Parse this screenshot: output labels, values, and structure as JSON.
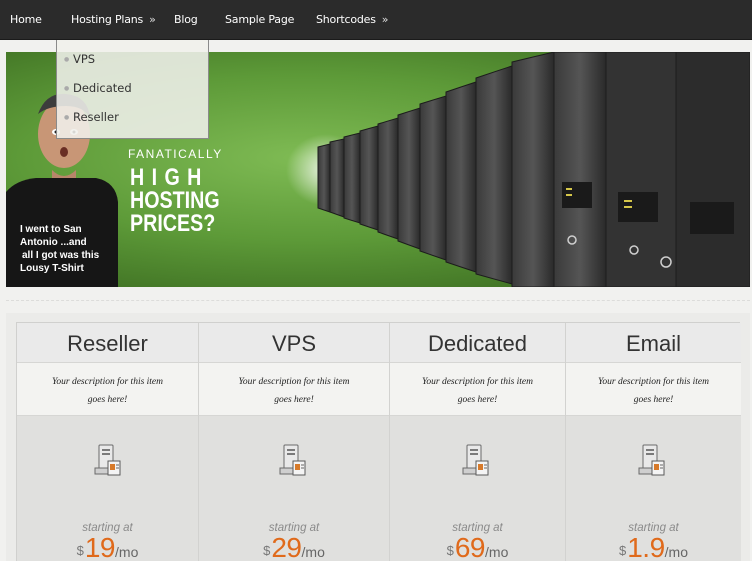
{
  "nav": {
    "items": [
      {
        "label": "Home"
      },
      {
        "label": "Hosting Plans",
        "arrow": "»"
      },
      {
        "label": "Blog"
      },
      {
        "label": "Sample Page"
      },
      {
        "label": "Shortcodes",
        "arrow": "»"
      }
    ]
  },
  "dropdown": {
    "items": [
      {
        "label": "VPS"
      },
      {
        "label": "Dedicated"
      },
      {
        "label": "Reseller"
      }
    ]
  },
  "banner": {
    "tagline_small": "FANATICALLY",
    "headline": [
      "HIGH",
      "HOSTING",
      "PRICES?"
    ],
    "tshirt_lines": [
      "I went to San",
      "Antonio ...and",
      "all I got was this",
      "Lousy T-Shirt"
    ],
    "accent": "#5d9a38"
  },
  "pricing": {
    "plans": [
      {
        "name": "Reseller",
        "desc_line1": "Your description for this item",
        "desc_line2": "goes here!",
        "starting": "starting at",
        "currency": "$",
        "amount": "19",
        "period": "/mo"
      },
      {
        "name": "VPS",
        "desc_line1": "Your description for this item",
        "desc_line2": "goes here!",
        "starting": "starting at",
        "currency": "$",
        "amount": "29",
        "period": "/mo"
      },
      {
        "name": "Dedicated",
        "desc_line1": "Your description for this item",
        "desc_line2": "goes here!",
        "starting": "starting at",
        "currency": "$",
        "amount": "69",
        "period": "/mo"
      },
      {
        "name": "Email",
        "desc_line1": "Your description for this item",
        "desc_line2": "goes here!",
        "starting": "starting at",
        "currency": "$",
        "amount": "1.9",
        "period": "/mo"
      }
    ],
    "price_color": "#e06a1b",
    "icon": "server-icon"
  }
}
